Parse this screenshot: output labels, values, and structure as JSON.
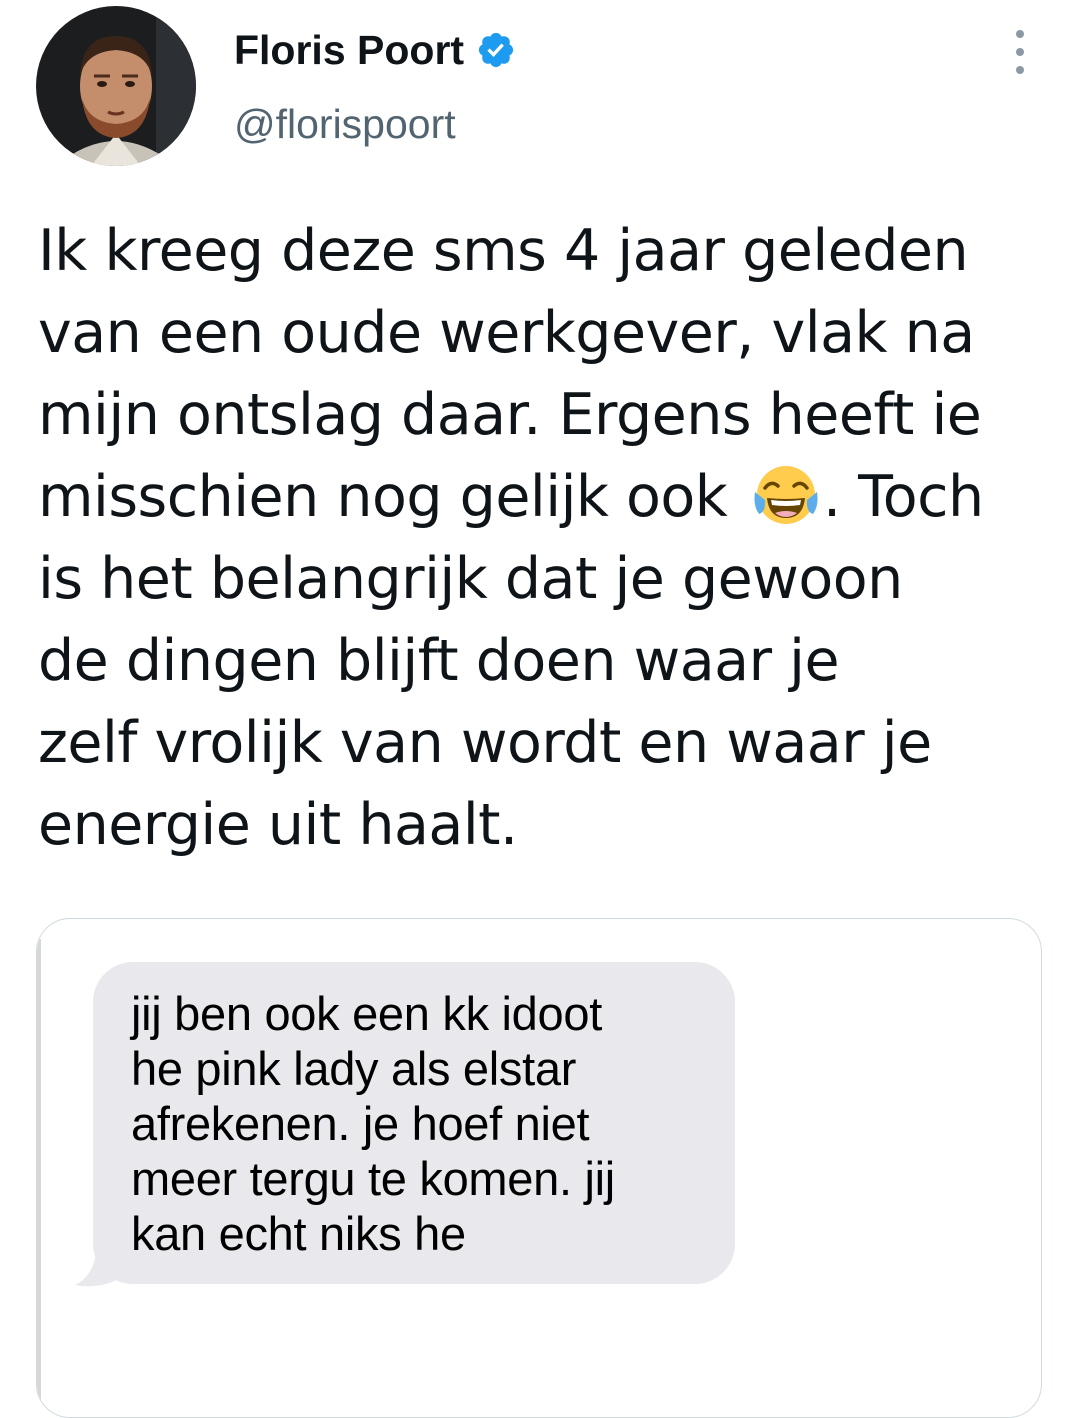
{
  "author": {
    "display_name": "Floris Poort",
    "handle": "@florispoort",
    "verified": true,
    "verified_color": "#1d9bf0"
  },
  "tweet": {
    "lines": [
      "Ik kreeg deze sms 4 jaar geleden",
      "van een oude werkgever, vlak na",
      "mijn ontslag daar. Ergens heeft ie",
      "misschien nog gelijk ook",
      ". Toch",
      "is het belangrijk dat je gewoon",
      "de dingen blijft doen waar je",
      "zelf vrolijk van wordt en waar je",
      "energie uit haalt."
    ],
    "emoji": "face-with-tears-of-joy"
  },
  "media": {
    "type": "sms-screenshot",
    "bubble_color": "#e8e8ed",
    "message_lines": [
      "jij ben ook een kk idoot",
      "he pink lady als elstar",
      "afrekenen. je hoef niet",
      "meer tergu te komen. jij",
      "kan echt niks he"
    ]
  },
  "icons": {
    "more": "more-options-icon",
    "verified": "verified-badge-icon"
  }
}
